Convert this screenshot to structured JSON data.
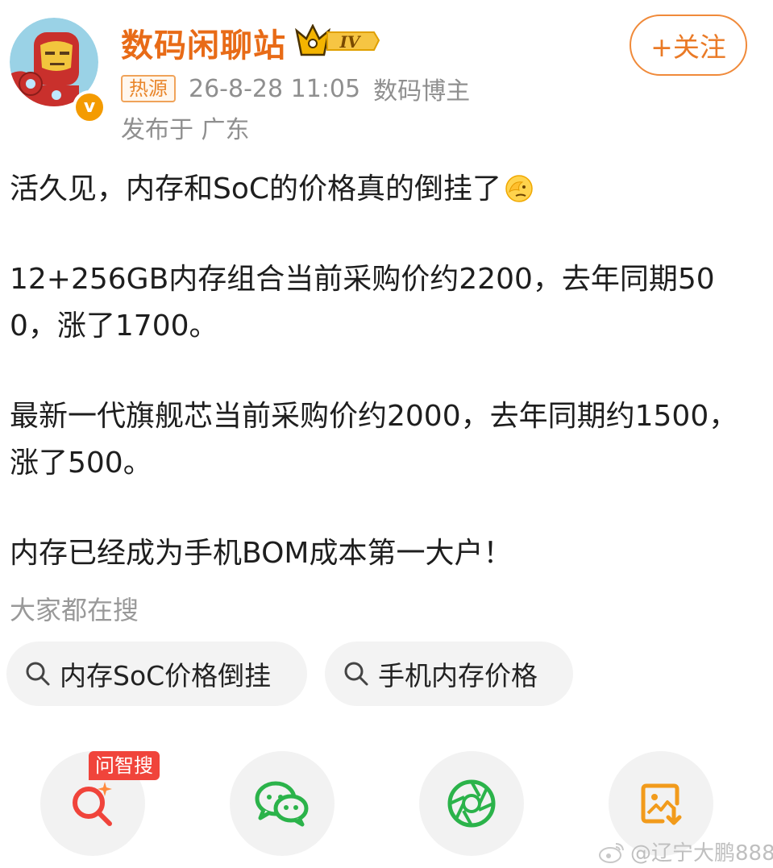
{
  "header": {
    "username": "数码闲聊站",
    "level": "IV",
    "hot_tag": "热源",
    "timestamp": "26-8-28 11:05",
    "role": "数码博主",
    "location": "发布于 广东",
    "follow_label": "+关注",
    "verified_icon": "v"
  },
  "post": {
    "paragraphs": [
      "活久见，内存和SoC的价格真的倒挂了",
      "12+256GB内存组合当前采购价约2200，去年同期500，涨了1700。",
      "最新一代旗舰芯当前采购价约2000，去年同期约1500，涨了500。",
      "内存已经成为手机BOM成本第一大户！"
    ],
    "emoji": "facepalm-emoji"
  },
  "searches": {
    "title": "大家都在搜",
    "items": [
      "内存SoC价格倒挂",
      "手机内存价格"
    ]
  },
  "share": {
    "ai_tag": "问智搜",
    "icons": [
      "ai-search-icon",
      "wechat-icon",
      "moments-icon",
      "save-image-icon"
    ]
  },
  "watermark": "@辽宁大鹏888",
  "colors": {
    "brand_orange": "#e86b17",
    "follow_orange": "#f08a3a",
    "meta_gray": "#8f8f8f",
    "ai_red": "#f0443b",
    "wechat_green": "#2bb34a"
  }
}
